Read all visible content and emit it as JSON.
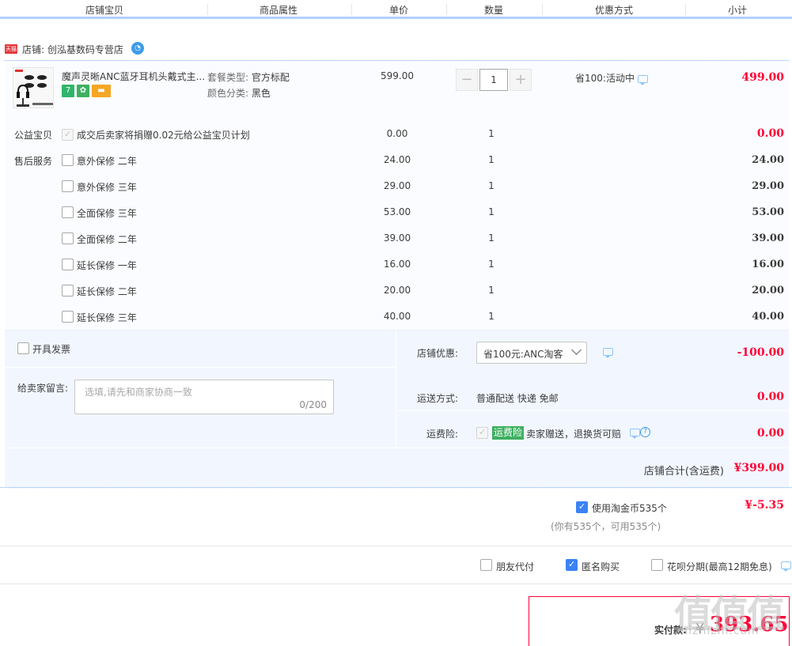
{
  "header": {
    "columns": [
      "店铺宝贝",
      "商品属性",
      "单价",
      "数量",
      "优惠方式",
      "小计"
    ]
  },
  "shop": {
    "badge": "天猫",
    "label": "店铺: 创泓基数码专营店"
  },
  "item": {
    "title": "魔声灵晰ANC蓝牙耳机头戴式主...",
    "attr1_label": "套餐类型:",
    "attr1_value": "官方标配",
    "attr2_label": "颜色分类:",
    "attr2_value": "黑色",
    "price": "599.00",
    "qty_minus": "−",
    "qty": "1",
    "qty_plus": "+",
    "promo": "省100:活动中",
    "subtotal": "499.00"
  },
  "charity": {
    "label": "公益宝贝",
    "text": "成交后卖家将捐赠0.02元给公益宝贝计划",
    "price": "0.00",
    "qty": "1",
    "subtotal": "0.00"
  },
  "after_sales": {
    "label": "售后服务",
    "items": [
      {
        "name": "意外保修 二年",
        "price": "24.00",
        "qty": "1",
        "subtotal": "24.00"
      },
      {
        "name": "意外保修 三年",
        "price": "29.00",
        "qty": "1",
        "subtotal": "29.00"
      },
      {
        "name": "全面保修 三年",
        "price": "53.00",
        "qty": "1",
        "subtotal": "53.00"
      },
      {
        "name": "全面保修 二年",
        "price": "39.00",
        "qty": "1",
        "subtotal": "39.00"
      },
      {
        "name": "延长保修 一年",
        "price": "16.00",
        "qty": "1",
        "subtotal": "16.00"
      },
      {
        "name": "延长保修 二年",
        "price": "20.00",
        "qty": "1",
        "subtotal": "20.00"
      },
      {
        "name": "延长保修 三年",
        "price": "40.00",
        "qty": "1",
        "subtotal": "40.00"
      }
    ]
  },
  "invoice": {
    "label": "开具发票"
  },
  "message": {
    "label": "给卖家留言:",
    "placeholder": "选填,请先和商家协商一致",
    "count": "0/200"
  },
  "shop_discount": {
    "label": "店铺优惠:",
    "selected": "省100元:ANC淘客",
    "value": "-100.00"
  },
  "shipping": {
    "label": "运送方式:",
    "value": "普通配送 快递 免邮",
    "fee": "0.00"
  },
  "insurance": {
    "label": "运费险:",
    "badge": "运费险",
    "text": "卖家赠送，退换货可赔",
    "fee": "0.00"
  },
  "shop_total": {
    "label": "店铺合计(含运费)",
    "value": "¥399.00"
  },
  "coins": {
    "label": "使用淘金币535个",
    "note": "(你有535个，可用535个)",
    "value": "¥-5.35"
  },
  "options": {
    "friend_pay": "朋友代付",
    "anonymous": "匿名购买",
    "huabei": "花呗分期(最高12期免息)"
  },
  "payment": {
    "label": "实付款:",
    "yen": "¥",
    "amount": "393.65"
  },
  "watermark": {
    "main": "值值值",
    "sub": "zhizhizhi.com"
  },
  "colors": {
    "accent_red": "#ff0036",
    "accent_blue": "#3b82f6",
    "panel_bg": "#f2f7ff",
    "header_border": "#b2d1ff"
  }
}
